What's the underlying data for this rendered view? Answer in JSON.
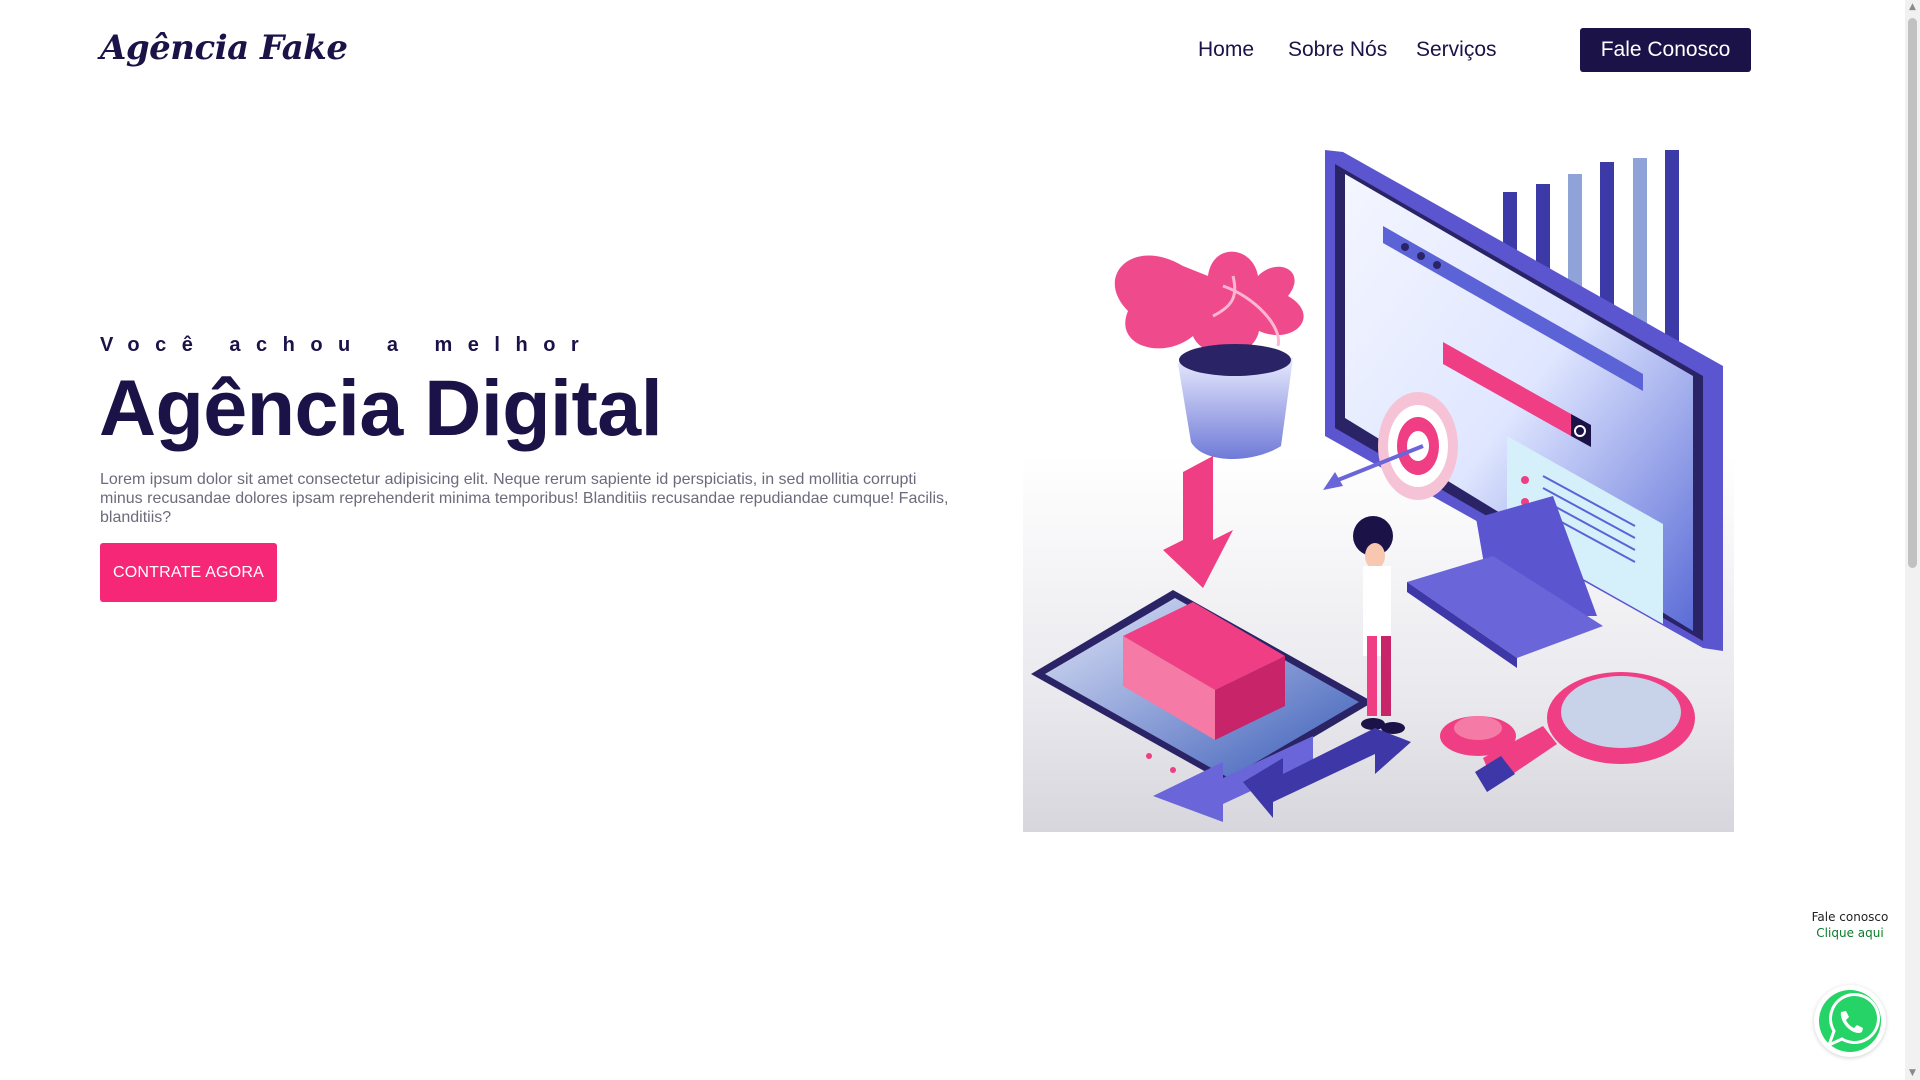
{
  "header": {
    "logo": "Agência Fake",
    "nav": [
      {
        "label": "Home"
      },
      {
        "label": "Sobre Nós"
      },
      {
        "label": "Serviços"
      }
    ],
    "cta": "Fale Conosco"
  },
  "hero": {
    "eyebrow": "Você achou a melhor",
    "title": "Agência Digital",
    "description": "Lorem ipsum dolor sit amet consectetur adipisicing elit. Neque rerum sapiente id perspiciatis, in sed mollitia corrupti minus recusandae dolores ipsam reprehenderit minima temporibus! Blanditiis recusandae repudiandae cumque! Facilis, blanditiis?",
    "button": "CONTRATE AGORA"
  },
  "whatsapp": {
    "title": "Fale conosco",
    "subtitle": "Clique aqui",
    "icon": "whatsapp-icon"
  },
  "colors": {
    "primary": "#1b1248",
    "accent": "#f72778",
    "whatsapp": "#25d366"
  }
}
